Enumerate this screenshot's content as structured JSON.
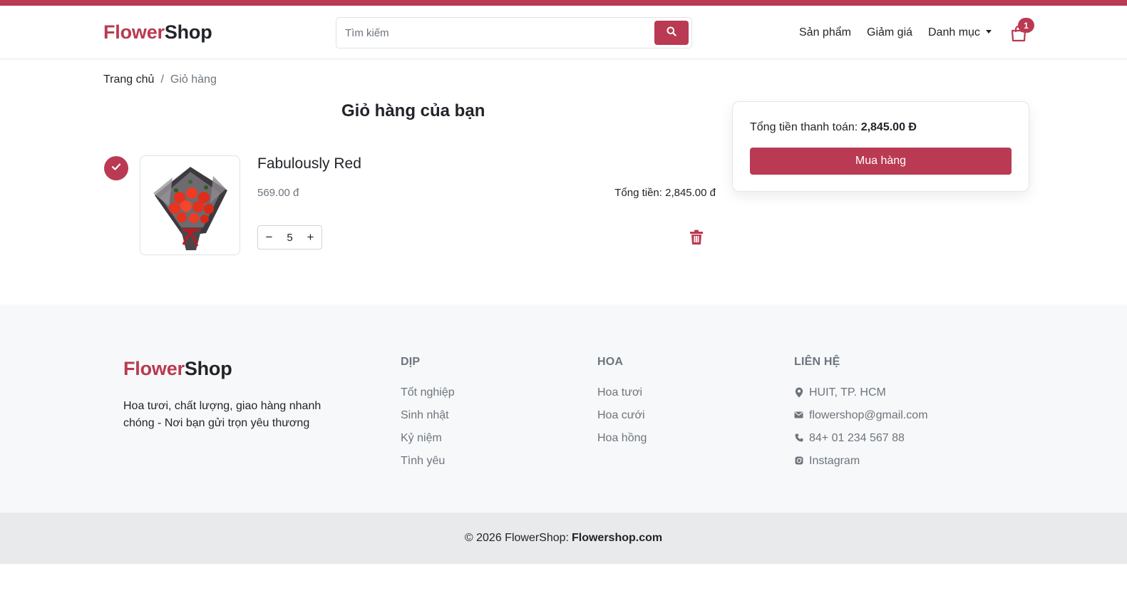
{
  "theme": {
    "accent": "#b93a52",
    "text": "#212529",
    "muted": "#6c757d"
  },
  "header": {
    "logo_part1": "Flower",
    "logo_part2": "Shop",
    "search_placeholder": "Tìm kiếm",
    "search_icon": "search-icon",
    "nav": {
      "products": "Sản phẩm",
      "discount": "Giảm giá",
      "categories": "Danh mục"
    },
    "cart_icon": "shopping-bag-icon",
    "cart_count": "1"
  },
  "breadcrumb": {
    "home": "Trang chủ",
    "separator": "/",
    "current": "Giỏ hàng"
  },
  "cart": {
    "title": "Giỏ hàng của bạn",
    "item": {
      "name": "Fabulously Red",
      "price": "569.00 đ",
      "line_total": "Tổng tiền: 2,845.00 đ",
      "quantity": "5",
      "minus": "−",
      "plus": "+",
      "selected": true,
      "image": "red-rose-bouquet"
    }
  },
  "summary": {
    "total_label": "Tổng tiền thanh toán:",
    "total_value": "2,845.00 Đ",
    "buy_label": "Mua hàng"
  },
  "footer": {
    "logo_part1": "Flower",
    "logo_part2": "Shop",
    "tagline": "Hoa tươi, chất lượng, giao hàng nhanh chóng - Nơi bạn gửi trọn yêu thương",
    "occasions": {
      "title": "DỊP",
      "items": [
        "Tốt nghiệp",
        "Sinh nhật",
        "Kỷ niệm",
        "Tình yêu"
      ]
    },
    "flowers": {
      "title": "HOA",
      "items": [
        "Hoa tươi",
        "Hoa cưới",
        "Hoa hồng"
      ]
    },
    "contact": {
      "title": "LIÊN HỆ",
      "address": "HUIT, TP. HCM",
      "email": "flowershop@gmail.com",
      "phone": "84+ 01 234 567 88",
      "instagram": "Instagram"
    },
    "copyright_text": "© 2026 FlowerShop:",
    "copyright_link": "Flowershop.com"
  }
}
